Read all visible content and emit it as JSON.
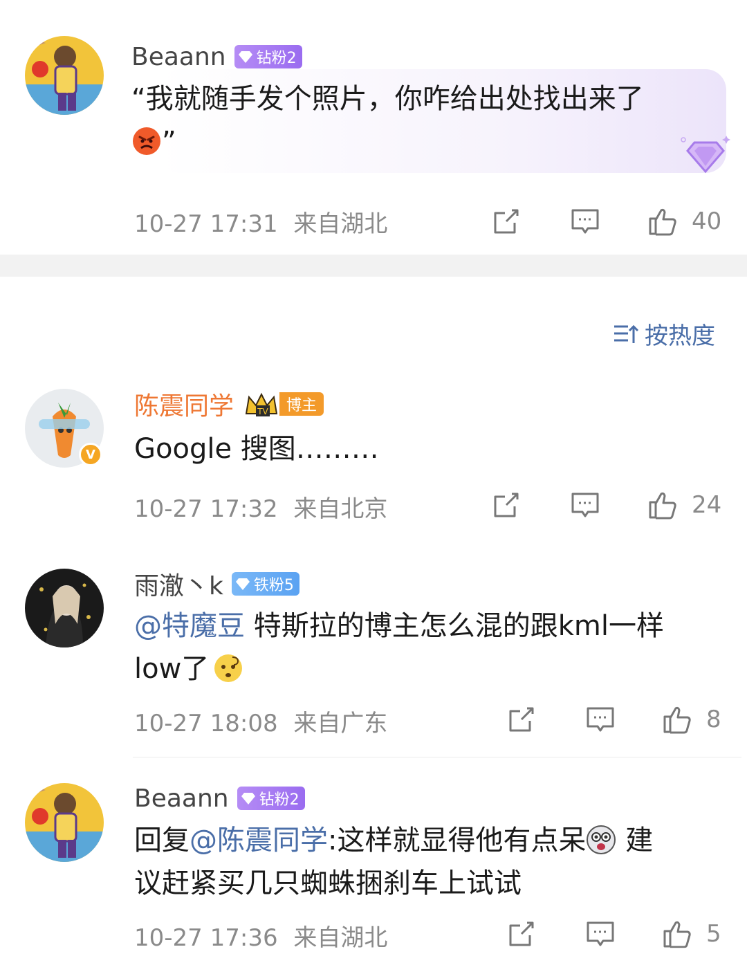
{
  "sort": {
    "label": "按热度"
  },
  "comments": [
    {
      "name": "Beaann",
      "badge": "钻粉2",
      "text_line1": "“我就随手发个照片，你咋给出处找出来了",
      "text_line2_tail": "”",
      "emoji": "angry-face",
      "time": "10-27 17:31",
      "location": "来自湖北",
      "likes": "40"
    },
    {
      "name": "陈震同学",
      "badge": "博主",
      "verified": "V",
      "text_line1": "Google 搜图………",
      "time": "10-27 17:32",
      "location": "来自北京",
      "likes": "24"
    },
    {
      "name": "雨澈丶k",
      "badge": "铁粉5",
      "mention": "@特魔豆",
      "text_line1_rest": " 特斯拉的博主怎么混的跟kml一样",
      "text_line2": "low了",
      "emoji": "thinking-face",
      "time": "10-27 18:08",
      "location": "来自广东",
      "likes": "8"
    },
    {
      "name": "Beaann",
      "badge": "钻粉2",
      "reply_prefix": "回复",
      "mention": "@陈震同学",
      "text_line1_rest": ":这样就显得他有点呆",
      "text_line1_tail": " 建",
      "text_line2": "议赶紧买几只蜘蛛捆刹车上试试",
      "emoji": "dizzy-face",
      "time": "10-27 17:36",
      "location": "来自湖北",
      "likes": "5"
    }
  ],
  "colors": {
    "mention": "#4a6ea8",
    "meta": "#8a8a8a",
    "author_name": "#ee7733"
  }
}
